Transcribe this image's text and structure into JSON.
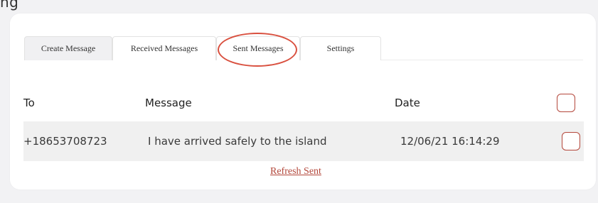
{
  "top_partial_text": "ng",
  "tabs": [
    {
      "label": "Create Message"
    },
    {
      "label": "Received Messages"
    },
    {
      "label": "Sent Messages"
    },
    {
      "label": "Settings"
    }
  ],
  "active_tab": "Sent Messages",
  "table": {
    "headers": {
      "to": "To",
      "message": "Message",
      "date": "Date"
    },
    "rows": [
      {
        "to": "+18653708723",
        "message": "I have arrived safely to the island",
        "date": "12/06/21 16:14:29"
      }
    ]
  },
  "refresh_label": "Refresh Sent",
  "colors": {
    "accent": "#b3473a",
    "annotation_circle": "#d9503f",
    "row_background": "#f0f0f0",
    "page_background": "#f2f2f4"
  }
}
